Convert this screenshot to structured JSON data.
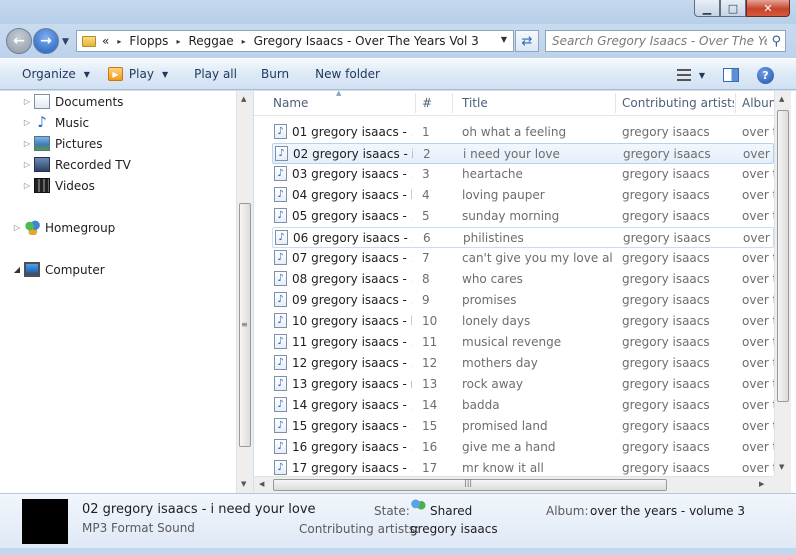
{
  "window": {
    "minimize_label": "▁",
    "maximize_label": "□",
    "close_label": "✕"
  },
  "address": {
    "overflow": "«",
    "crumbs": [
      "Flopps",
      "Reggae",
      "Gregory Isaacs - Over The Years Vol 3"
    ],
    "separator": "▸"
  },
  "search": {
    "placeholder": "Search Gregory Isaacs - Over The Years..."
  },
  "toolbar": {
    "organize": "Organize",
    "play": "Play",
    "play_all": "Play all",
    "burn": "Burn",
    "new_folder": "New folder"
  },
  "nav": {
    "items": [
      {
        "label": "Documents",
        "icon": "documents-icon"
      },
      {
        "label": "Music",
        "icon": "music-icon"
      },
      {
        "label": "Pictures",
        "icon": "pictures-icon"
      },
      {
        "label": "Recorded TV",
        "icon": "recorded-tv-icon"
      },
      {
        "label": "Videos",
        "icon": "videos-icon"
      },
      {
        "label": "Homegroup",
        "icon": "homegroup-icon"
      },
      {
        "label": "Computer",
        "icon": "computer-icon"
      }
    ]
  },
  "columns": {
    "name": "Name",
    "num": "#",
    "title": "Title",
    "artists": "Contributing artists",
    "album": "Album"
  },
  "files": [
    {
      "name": "01 gregory isaacs - ...",
      "num": "1",
      "title": "oh what a feeling",
      "artist": "gregory isaacs",
      "album": "over t"
    },
    {
      "name": "02 gregory isaacs - i...",
      "num": "2",
      "title": "i need your love",
      "artist": "gregory isaacs",
      "album": "over t"
    },
    {
      "name": "03 gregory isaacs - ...",
      "num": "3",
      "title": "heartache",
      "artist": "gregory isaacs",
      "album": "over t"
    },
    {
      "name": "04 gregory isaacs - l...",
      "num": "4",
      "title": "loving pauper",
      "artist": "gregory isaacs",
      "album": "over t"
    },
    {
      "name": "05 gregory isaacs - ...",
      "num": "5",
      "title": "sunday morning",
      "artist": "gregory isaacs",
      "album": "over t"
    },
    {
      "name": "06 gregory isaacs - ...",
      "num": "6",
      "title": "philistines",
      "artist": "gregory isaacs",
      "album": "over t"
    },
    {
      "name": "07 gregory isaacs - ...",
      "num": "7",
      "title": "can't give you my love al...",
      "artist": "gregory isaacs",
      "album": "over t"
    },
    {
      "name": "08 gregory isaacs - ...",
      "num": "8",
      "title": "who cares",
      "artist": "gregory isaacs",
      "album": "over t"
    },
    {
      "name": "09 gregory isaacs - ...",
      "num": "9",
      "title": "promises",
      "artist": "gregory isaacs",
      "album": "over t"
    },
    {
      "name": "10 gregory isaacs - l...",
      "num": "10",
      "title": "lonely days",
      "artist": "gregory isaacs",
      "album": "over t"
    },
    {
      "name": "11 gregory isaacs - ...",
      "num": "11",
      "title": "musical revenge",
      "artist": "gregory isaacs",
      "album": "over t"
    },
    {
      "name": "12 gregory isaacs - ...",
      "num": "12",
      "title": "mothers day",
      "artist": "gregory isaacs",
      "album": "over t"
    },
    {
      "name": "13 gregory isaacs - r...",
      "num": "13",
      "title": "rock away",
      "artist": "gregory isaacs",
      "album": "over t"
    },
    {
      "name": "14 gregory isaacs - ...",
      "num": "14",
      "title": "badda",
      "artist": "gregory isaacs",
      "album": "over t"
    },
    {
      "name": "15 gregory isaacs - ...",
      "num": "15",
      "title": "promised land",
      "artist": "gregory isaacs",
      "album": "over t"
    },
    {
      "name": "16 gregory isaacs - ...",
      "num": "16",
      "title": "give me a hand",
      "artist": "gregory isaacs",
      "album": "over t"
    },
    {
      "name": "17 gregory isaacs - ...",
      "num": "17",
      "title": "mr know it all",
      "artist": "gregory isaacs",
      "album": "over t"
    }
  ],
  "selected_index": 1,
  "focused_index": 5,
  "details": {
    "title": "02 gregory isaacs - i need your love",
    "type": "MP3 Format Sound",
    "state_label": "State:",
    "state_value": "Shared",
    "artists_label": "Contributing artists:",
    "artists_value": "gregory isaacs",
    "album_label": "Album:",
    "album_value": "over the years - volume 3"
  }
}
